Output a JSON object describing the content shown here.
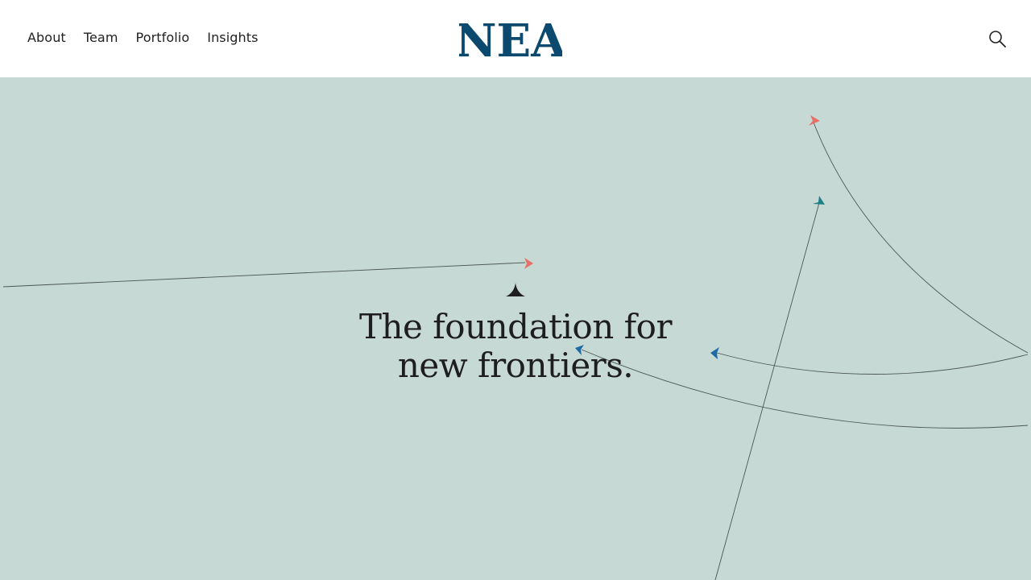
{
  "nav": {
    "items": [
      {
        "label": "About"
      },
      {
        "label": "Team"
      },
      {
        "label": "Portfolio"
      },
      {
        "label": "Insights"
      }
    ]
  },
  "logo": {
    "text": "NEA",
    "color": "#0b4a6e"
  },
  "search": {
    "icon": "search-icon"
  },
  "hero": {
    "background": "#c6d9d4",
    "headline_line1": "The foundation for",
    "headline_line2": "new frontiers."
  },
  "colors": {
    "coral": "#e8706a",
    "teal": "#1f7f86",
    "blue": "#1d6aa6",
    "line": "#4d5856"
  }
}
